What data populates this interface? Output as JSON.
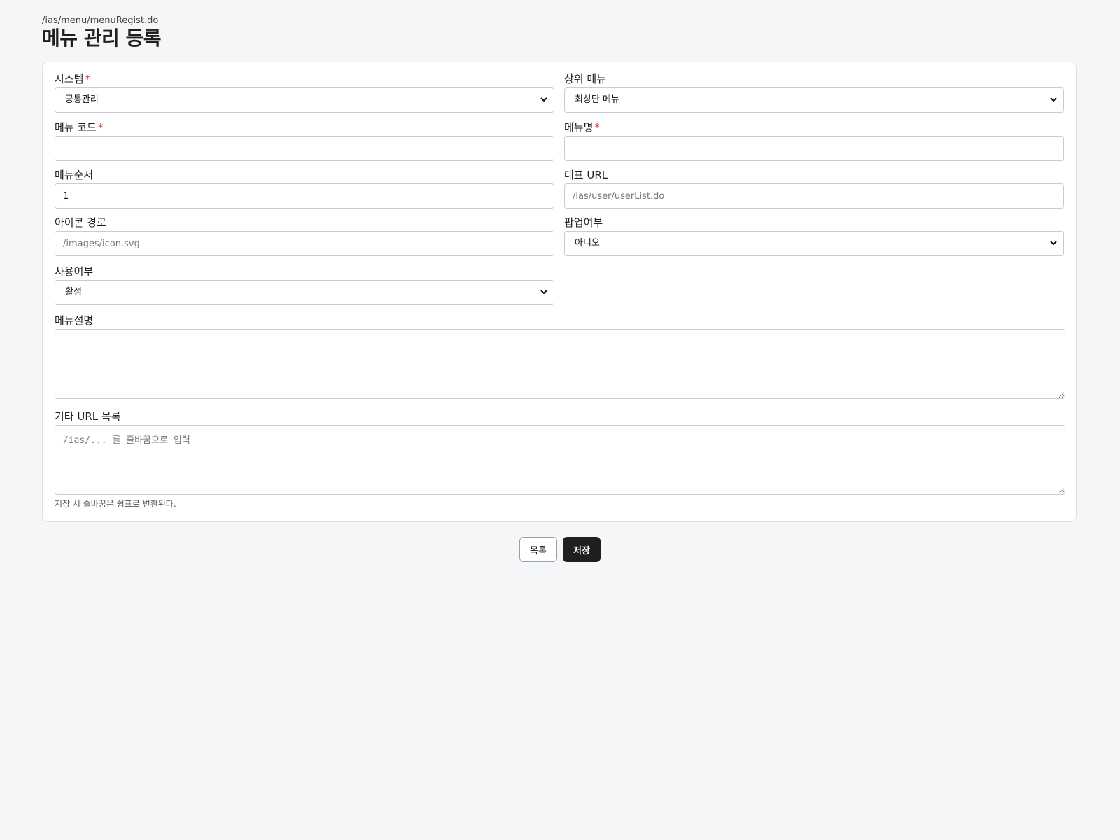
{
  "header": {
    "route": "/ias/menu/menuRegist.do",
    "title": "메뉴 관리 등록"
  },
  "form": {
    "required_mark": "*",
    "system": {
      "label": "시스템",
      "value": "공통관리"
    },
    "parent_menu": {
      "label": "상위 메뉴",
      "value": "최상단 메뉴"
    },
    "menu_code": {
      "label": "메뉴 코드",
      "value": "",
      "placeholder": ""
    },
    "menu_name": {
      "label": "메뉴명",
      "value": "",
      "placeholder": ""
    },
    "menu_order": {
      "label": "메뉴순서",
      "value": "1"
    },
    "main_url": {
      "label": "대표 URL",
      "placeholder": "/ias/user/userList.do"
    },
    "icon_path": {
      "label": "아이콘 경로",
      "placeholder": "/images/icon.svg"
    },
    "popup": {
      "label": "팝업여부",
      "value": "아니오"
    },
    "use_yn": {
      "label": "사용여부",
      "value": "활성"
    },
    "description": {
      "label": "메뉴설명",
      "placeholder": ""
    },
    "extra_urls": {
      "label": "기타 URL 목록",
      "placeholder": "/ias/... 를 줄바꿈으로 입력",
      "help": "저장 시 줄바꿈은 쉼표로 변환된다."
    }
  },
  "actions": {
    "list_label": "목록",
    "save_label": "저장"
  },
  "icons": {
    "select_arrow": "chevron-down-icon"
  },
  "colors": {
    "required": "#d62828",
    "primary_button": "#1f1f1f"
  }
}
